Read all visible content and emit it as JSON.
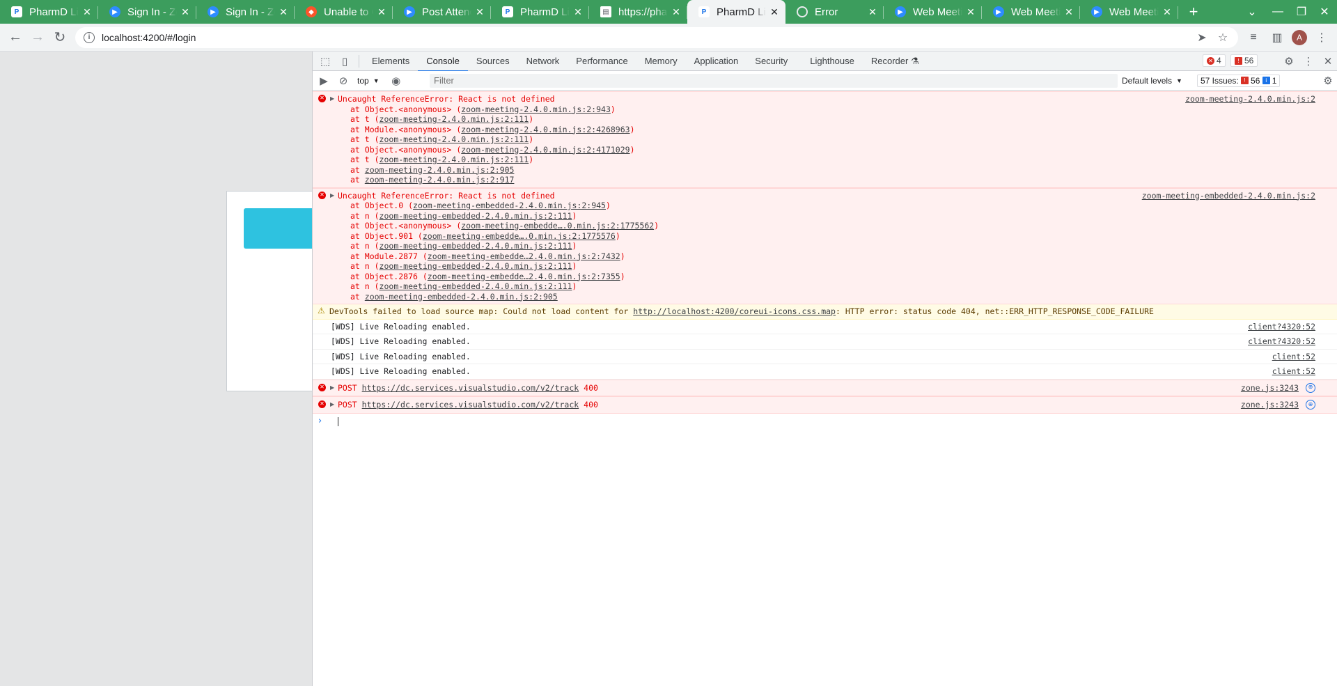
{
  "tabs": [
    {
      "title": "PharmD Live",
      "icon": "pharmd",
      "active": false
    },
    {
      "title": "Sign In - Zoom",
      "icon": "zoom",
      "active": false
    },
    {
      "title": "Sign In - Zoom",
      "icon": "zoom",
      "active": false
    },
    {
      "title": "Unable to Connect",
      "icon": "brave",
      "active": false
    },
    {
      "title": "Post Attendee",
      "icon": "zoom",
      "active": false
    },
    {
      "title": "PharmD Live",
      "icon": "pharmd",
      "active": false
    },
    {
      "title": "https://pharmd",
      "icon": "doc",
      "active": false
    },
    {
      "title": "PharmD Live",
      "icon": "pharmd",
      "active": true
    },
    {
      "title": "Error",
      "icon": "globe",
      "active": false
    },
    {
      "title": "Web Meeting",
      "icon": "zoom",
      "active": false
    },
    {
      "title": "Web Meeting",
      "icon": "zoom",
      "active": false
    },
    {
      "title": "Web Meeting",
      "icon": "zoom",
      "active": false
    }
  ],
  "address": {
    "url": "localhost:4200/#/login"
  },
  "profile": {
    "initial": "A"
  },
  "devtools": {
    "tabs": [
      "Elements",
      "Console",
      "Sources",
      "Network",
      "Performance",
      "Memory",
      "Application",
      "Security",
      "Lighthouse",
      "Recorder"
    ],
    "active_tab": "Console",
    "error_count": "4",
    "issue_count": "56",
    "context": "top",
    "filter_placeholder": "Filter",
    "levels": "Default levels",
    "issues_label": "57 Issues:",
    "issues_errors": "56",
    "issues_info": "1"
  },
  "console": {
    "error1": {
      "head": "Uncaught ReferenceError: React is not defined",
      "source": "zoom-meeting-2.4.0.min.js:2",
      "stack": [
        {
          "prefix": "at Object.<anonymous> (",
          "link": "zoom-meeting-2.4.0.min.js:2:943",
          "suffix": ")"
        },
        {
          "prefix": "at t (",
          "link": "zoom-meeting-2.4.0.min.js:2:111",
          "suffix": ")"
        },
        {
          "prefix": "at Module.<anonymous> (",
          "link": "zoom-meeting-2.4.0.min.js:2:4268963",
          "suffix": ")"
        },
        {
          "prefix": "at t (",
          "link": "zoom-meeting-2.4.0.min.js:2:111",
          "suffix": ")"
        },
        {
          "prefix": "at Object.<anonymous> (",
          "link": "zoom-meeting-2.4.0.min.js:2:4171029",
          "suffix": ")"
        },
        {
          "prefix": "at t (",
          "link": "zoom-meeting-2.4.0.min.js:2:111",
          "suffix": ")"
        },
        {
          "prefix": "at ",
          "link": "zoom-meeting-2.4.0.min.js:2:905",
          "suffix": ""
        },
        {
          "prefix": "at ",
          "link": "zoom-meeting-2.4.0.min.js:2:917",
          "suffix": ""
        }
      ]
    },
    "error2": {
      "head": "Uncaught ReferenceError: React is not defined",
      "source": "zoom-meeting-embedded-2.4.0.min.js:2",
      "stack": [
        {
          "prefix": "at Object.0 (",
          "link": "zoom-meeting-embedded-2.4.0.min.js:2:945",
          "suffix": ")"
        },
        {
          "prefix": "at n (",
          "link": "zoom-meeting-embedded-2.4.0.min.js:2:111",
          "suffix": ")"
        },
        {
          "prefix": "at Object.<anonymous> (",
          "link": "zoom-meeting-embedde….0.min.js:2:1775562",
          "suffix": ")"
        },
        {
          "prefix": "at Object.901 (",
          "link": "zoom-meeting-embedde….0.min.js:2:1775576",
          "suffix": ")"
        },
        {
          "prefix": "at n (",
          "link": "zoom-meeting-embedded-2.4.0.min.js:2:111",
          "suffix": ")"
        },
        {
          "prefix": "at Module.2877 (",
          "link": "zoom-meeting-embedde…2.4.0.min.js:2:7432",
          "suffix": ")"
        },
        {
          "prefix": "at n (",
          "link": "zoom-meeting-embedded-2.4.0.min.js:2:111",
          "suffix": ")"
        },
        {
          "prefix": "at Object.2876 (",
          "link": "zoom-meeting-embedde…2.4.0.min.js:2:7355",
          "suffix": ")"
        },
        {
          "prefix": "at n (",
          "link": "zoom-meeting-embedded-2.4.0.min.js:2:111",
          "suffix": ")"
        },
        {
          "prefix": "at ",
          "link": "zoom-meeting-embedded-2.4.0.min.js:2:905",
          "suffix": ""
        }
      ]
    },
    "warning": {
      "prefix": "DevTools failed to load source map: Could not load content for ",
      "link": "http://localhost:4200/coreui-icons.css.map",
      "suffix": ": HTTP error: status code 404, net::ERR_HTTP_RESPONSE_CODE_FAILURE"
    },
    "info": [
      {
        "text": "[WDS] Live Reloading enabled.",
        "source": "client?4320:52"
      },
      {
        "text": "[WDS] Live Reloading enabled.",
        "source": "client?4320:52"
      },
      {
        "text": "[WDS] Live Reloading enabled.",
        "source": "client:52"
      },
      {
        "text": "[WDS] Live Reloading enabled.",
        "source": "client:52"
      }
    ],
    "posts": [
      {
        "method": "POST",
        "url": "https://dc.services.visualstudio.com/v2/track",
        "status": "400",
        "source": "zone.js:3243"
      },
      {
        "method": "POST",
        "url": "https://dc.services.visualstudio.com/v2/track",
        "status": "400",
        "source": "zone.js:3243"
      }
    ]
  }
}
